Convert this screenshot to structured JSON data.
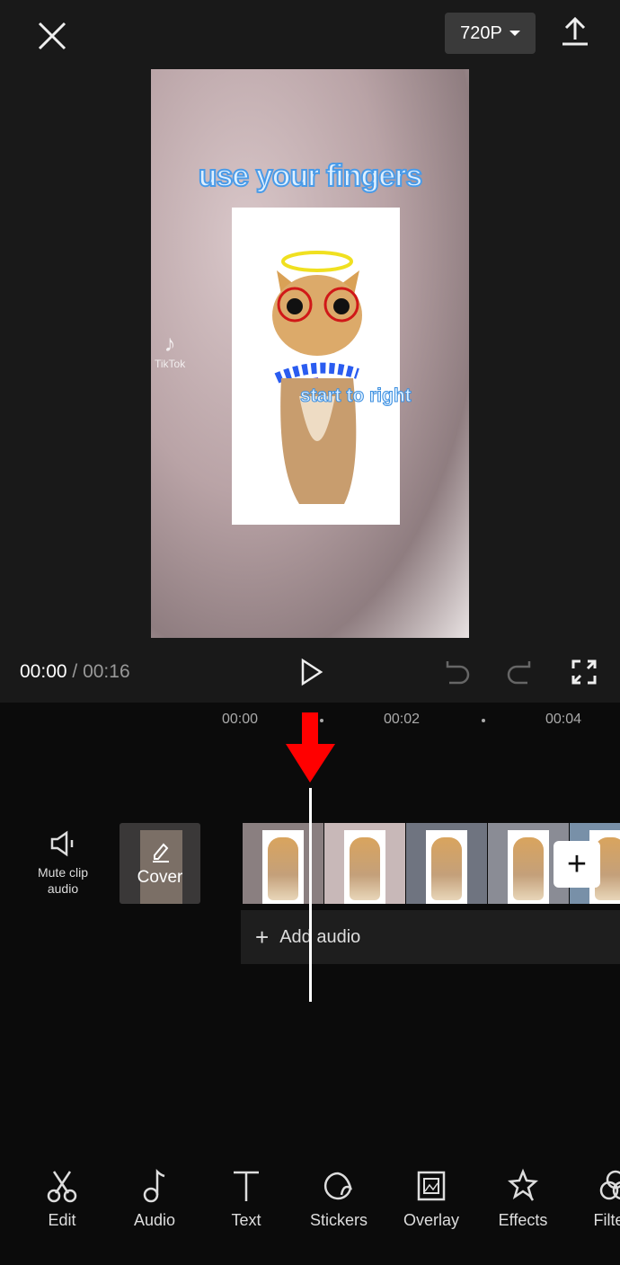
{
  "header": {
    "resolution": "720P",
    "close_icon": "close-icon",
    "export_icon": "upload-icon"
  },
  "preview": {
    "headline": "use your fingers",
    "caption": "start to right",
    "watermark": "TikTok"
  },
  "playback": {
    "current": "00:00",
    "separator": " / ",
    "total": "00:16"
  },
  "timeline": {
    "ticks": [
      "00:00",
      "00:02",
      "00:04"
    ],
    "mute_label": "Mute clip audio",
    "cover_label": "Cover",
    "add_audio_label": "Add audio",
    "add_clip_label": "+"
  },
  "annotation": {
    "arrow_color": "#ff0000"
  },
  "toolbar": {
    "items": [
      {
        "label": "Edit",
        "icon": "scissors-icon"
      },
      {
        "label": "Audio",
        "icon": "music-note-icon"
      },
      {
        "label": "Text",
        "icon": "text-icon"
      },
      {
        "label": "Stickers",
        "icon": "sticker-icon"
      },
      {
        "label": "Overlay",
        "icon": "overlay-icon"
      },
      {
        "label": "Effects",
        "icon": "star-icon"
      },
      {
        "label": "Filters",
        "icon": "filters-icon"
      }
    ]
  }
}
